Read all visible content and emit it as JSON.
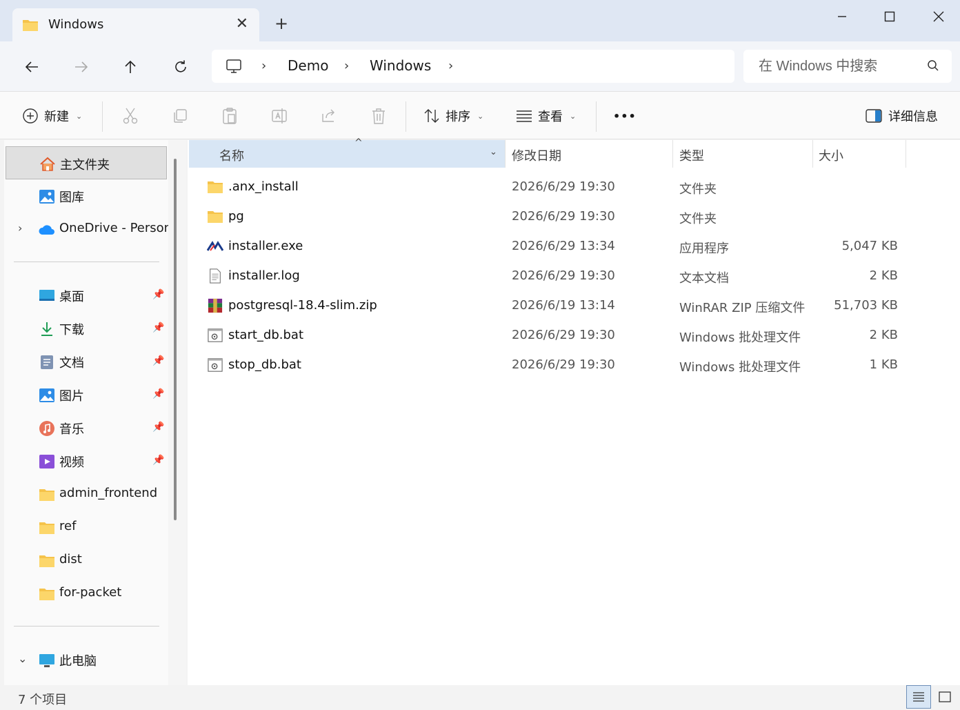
{
  "window": {
    "tab_title": "Windows",
    "tab_close": "✕",
    "new_tab": "+"
  },
  "nav": {
    "breadcrumbs": [
      "Demo",
      "Windows"
    ],
    "search_placeholder": "在 Windows 中搜索"
  },
  "commands": {
    "new_label": "新建",
    "sort_label": "排序",
    "view_label": "查看",
    "more_label": "•••",
    "details_label": "详细信息"
  },
  "sidebar": {
    "home": "主文件夹",
    "gallery": "图库",
    "onedrive": "OneDrive - Person",
    "pinned": [
      {
        "label": "桌面",
        "icon": "desktop-icon"
      },
      {
        "label": "下载",
        "icon": "download-icon"
      },
      {
        "label": "文档",
        "icon": "document-icon"
      },
      {
        "label": "图片",
        "icon": "pictures-icon"
      },
      {
        "label": "音乐",
        "icon": "music-icon"
      },
      {
        "label": "视频",
        "icon": "video-icon"
      }
    ],
    "folders": [
      "admin_frontend",
      "ref",
      "dist",
      "for-packet"
    ],
    "this_pc": "此电脑"
  },
  "columns": {
    "name": "名称",
    "date": "修改日期",
    "type": "类型",
    "size": "大小"
  },
  "files": [
    {
      "name": ".anx_install",
      "date": "2026/6/29 19:30",
      "type": "文件夹",
      "size": "",
      "icon": "folder-icon"
    },
    {
      "name": "pg",
      "date": "2026/6/29 19:30",
      "type": "文件夹",
      "size": "",
      "icon": "folder-icon"
    },
    {
      "name": "installer.exe",
      "date": "2026/6/29 13:34",
      "type": "应用程序",
      "size": "5,047 KB",
      "icon": "exe-icon"
    },
    {
      "name": "installer.log",
      "date": "2026/6/29 19:30",
      "type": "文本文档",
      "size": "2 KB",
      "icon": "text-file-icon"
    },
    {
      "name": "postgresql-18.4-slim.zip",
      "date": "2026/6/19 13:14",
      "type": "WinRAR ZIP 压缩文件",
      "size": "51,703 KB",
      "icon": "winrar-icon"
    },
    {
      "name": "start_db.bat",
      "date": "2026/6/29 19:30",
      "type": "Windows 批处理文件",
      "size": "2 KB",
      "icon": "batch-file-icon"
    },
    {
      "name": "stop_db.bat",
      "date": "2026/6/29 19:30",
      "type": "Windows 批处理文件",
      "size": "1 KB",
      "icon": "batch-file-icon"
    }
  ],
  "status": {
    "item_count": "7 个项目"
  },
  "colors": {
    "accent": "#0067c0",
    "folder": "#f5c34b",
    "selection": "#d8e6f5"
  }
}
